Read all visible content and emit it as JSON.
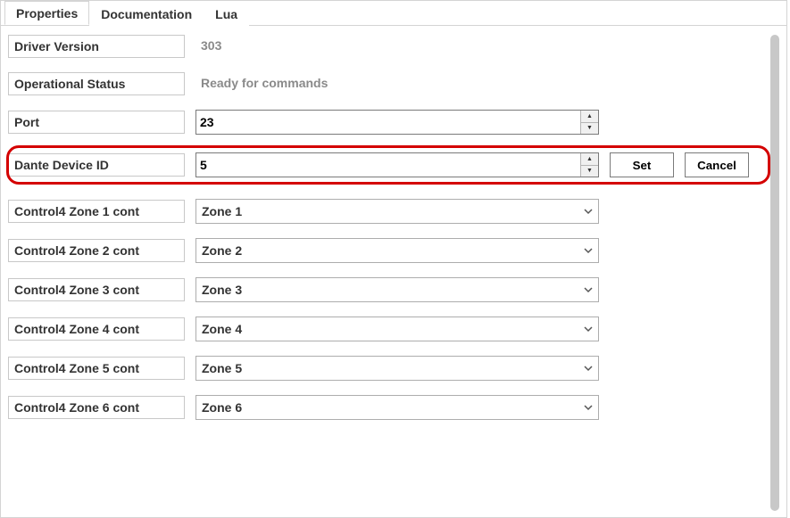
{
  "tabs": {
    "properties": "Properties",
    "documentation": "Documentation",
    "lua": "Lua"
  },
  "rows": {
    "driver_version": {
      "label": "Driver Version",
      "value": "303"
    },
    "operational_status": {
      "label": "Operational Status",
      "value": "Ready for commands"
    },
    "port": {
      "label": "Port",
      "value": "23"
    },
    "dante_device_id": {
      "label": "Dante Device ID",
      "value": "5"
    },
    "zone1": {
      "label": "Control4 Zone 1 cont",
      "value": "Zone 1"
    },
    "zone2": {
      "label": "Control4 Zone 2 cont",
      "value": "Zone 2"
    },
    "zone3": {
      "label": "Control4 Zone 3 cont",
      "value": "Zone 3"
    },
    "zone4": {
      "label": "Control4 Zone 4 cont",
      "value": "Zone 4"
    },
    "zone5": {
      "label": "Control4 Zone 5 cont",
      "value": "Zone 5"
    },
    "zone6": {
      "label": "Control4 Zone 6 cont",
      "value": "Zone 6"
    }
  },
  "buttons": {
    "set": "Set",
    "cancel": "Cancel"
  }
}
